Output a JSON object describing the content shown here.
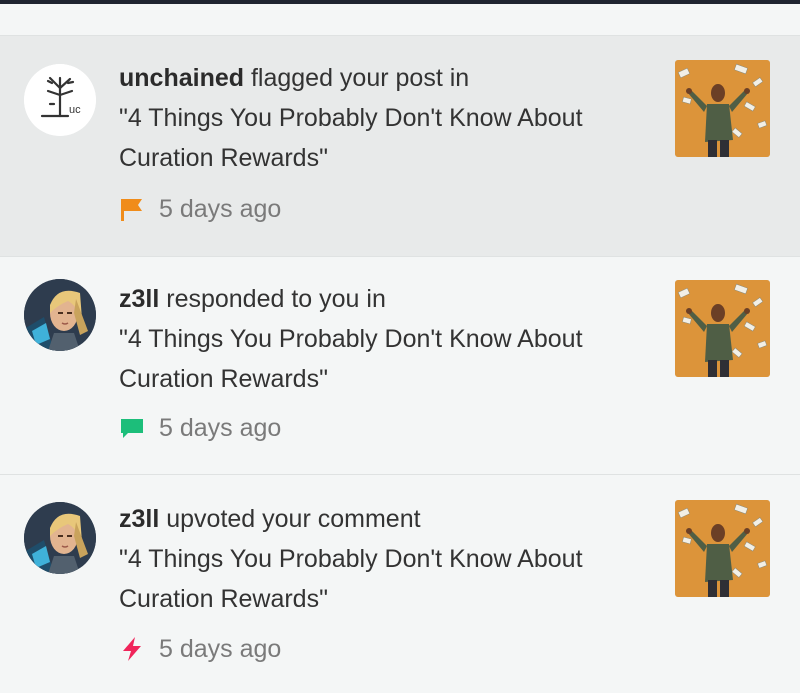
{
  "notifications": [
    {
      "username": "unchained",
      "action": " flagged your post in",
      "post_title": " \"4 Things You Probably Don't Know About Curation Rewards\"",
      "time": "5 days ago",
      "icon": "flag-icon",
      "icon_color": "#f08c1a",
      "avatar": "unchained-logo-avatar",
      "unread": true
    },
    {
      "username": "z3ll",
      "action": " responded to you in",
      "post_title": " \"4 Things You Probably Don't Know About Curation Rewards\"",
      "time": "5 days ago",
      "icon": "comment-icon",
      "icon_color": "#1cbe7a",
      "avatar": "z3ll-avatar",
      "unread": false
    },
    {
      "username": "z3ll",
      "action": " upvoted your comment",
      "post_title": " \"4 Things You Probably Don't Know About Curation Rewards\"",
      "time": "5 days ago",
      "icon": "lightning-icon",
      "icon_color": "#f0245a",
      "avatar": "z3ll-avatar",
      "unread": false
    }
  ],
  "colors": {
    "background": "#f4f6f6",
    "unread_background": "#e8eaea",
    "thumbnail_background": "#e39a3c"
  }
}
